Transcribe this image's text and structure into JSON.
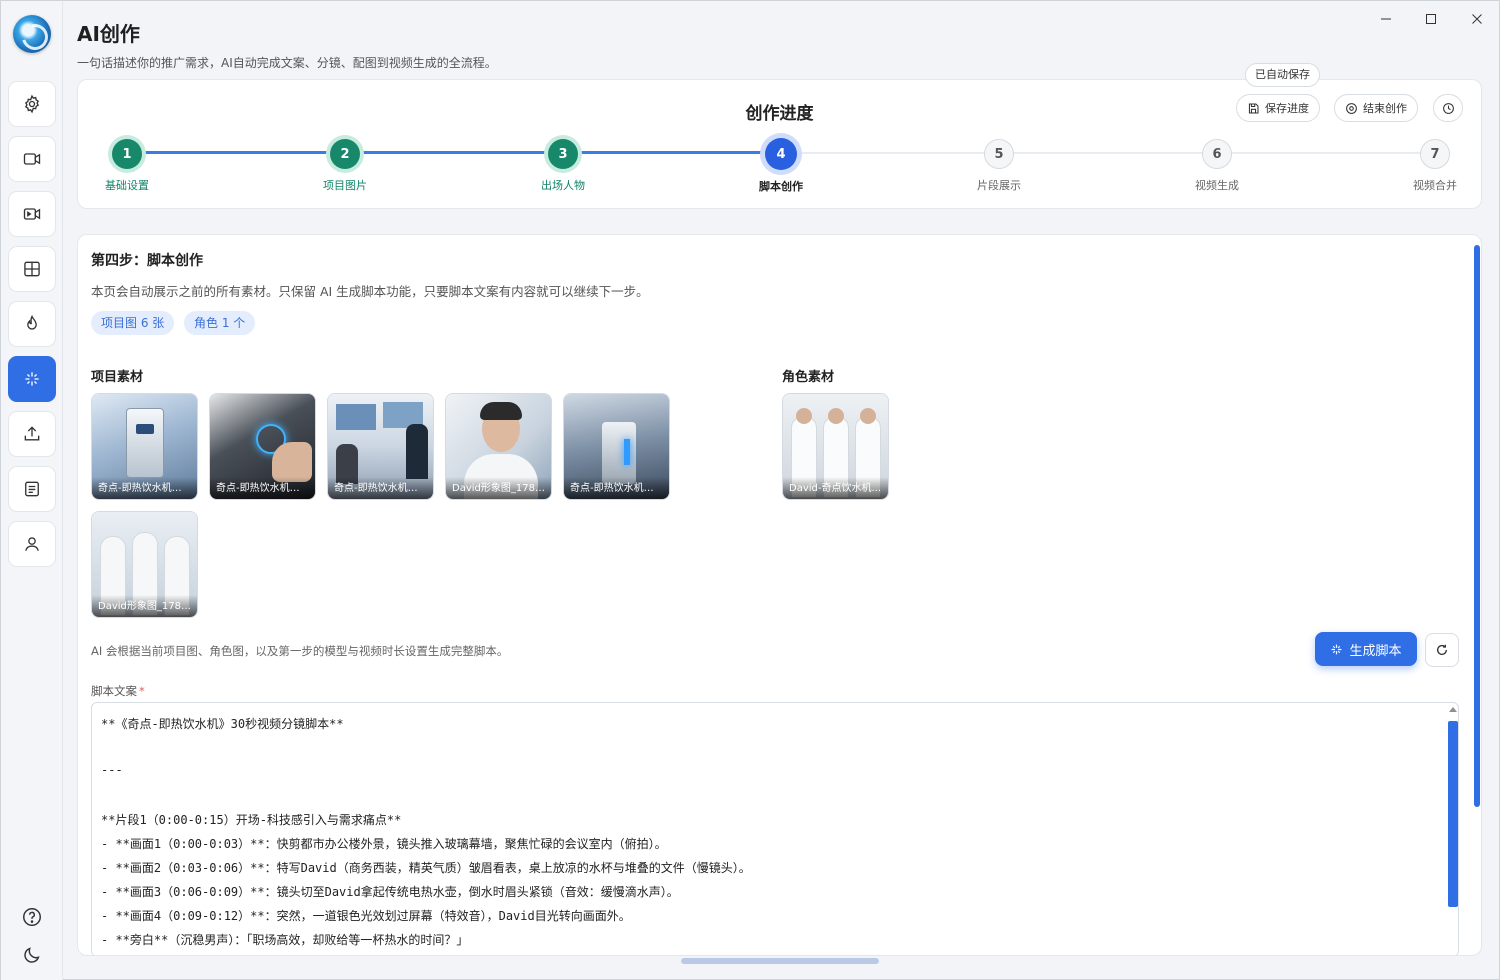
{
  "app": {
    "title": "AI创作",
    "subtitle": "一句话描述你的推广需求，AI自动完成文案、分镜、配图到视频生成的全流程。"
  },
  "sidebar": {
    "items": [
      {
        "name": "settings",
        "icon": "gear-icon"
      },
      {
        "name": "video",
        "icon": "video-camera-icon"
      },
      {
        "name": "video-record",
        "icon": "video-record-icon"
      },
      {
        "name": "grid",
        "icon": "grid-icon"
      },
      {
        "name": "hot",
        "icon": "flame-icon"
      },
      {
        "name": "ai-create",
        "icon": "sparkle-icon",
        "active": true
      },
      {
        "name": "upload",
        "icon": "upload-icon"
      },
      {
        "name": "document",
        "icon": "document-icon"
      },
      {
        "name": "user",
        "icon": "user-icon"
      }
    ],
    "bottom": [
      {
        "name": "help",
        "icon": "help-icon"
      },
      {
        "name": "theme",
        "icon": "moon-icon"
      }
    ]
  },
  "progress": {
    "title": "创作进度",
    "autosave": "已自动保存",
    "save_label": "保存进度",
    "end_label": "结束创作",
    "steps": [
      {
        "num": "1",
        "label": "基础设置",
        "state": "done"
      },
      {
        "num": "2",
        "label": "项目图片",
        "state": "done"
      },
      {
        "num": "3",
        "label": "出场人物",
        "state": "done"
      },
      {
        "num": "4",
        "label": "脚本创作",
        "state": "current"
      },
      {
        "num": "5",
        "label": "片段展示",
        "state": "todo"
      },
      {
        "num": "6",
        "label": "视频生成",
        "state": "todo"
      },
      {
        "num": "7",
        "label": "视频合并",
        "state": "todo"
      }
    ]
  },
  "main": {
    "step_title": "第四步：脚本创作",
    "description": "本页会自动展示之前的所有素材。只保留 AI 生成脚本功能，只要脚本文案有内容就可以继续下一步。",
    "chips": [
      "项目图 6 张",
      "角色 1 个"
    ],
    "project_section_title": "项目素材",
    "role_section_title": "角色素材",
    "project_images": [
      {
        "caption": "奇点-即热饮水机项..."
      },
      {
        "caption": "奇点-即热饮水机项..."
      },
      {
        "caption": "奇点-即热饮水机项..."
      },
      {
        "caption": "David形象图_17800..."
      },
      {
        "caption": "奇点-即热饮水机项..."
      },
      {
        "caption": "David形象图_17800..."
      }
    ],
    "role_images": [
      {
        "caption": "David-奇点饮水机..."
      }
    ],
    "ai_note": "AI 会根据当前项目图、角色图，以及第一步的模型与视频时长设置生成完整脚本。",
    "generate_label": "生成脚本",
    "script_label": "脚本文案",
    "script_required": "*",
    "script_lines": [
      "**《奇点-即热饮水机》30秒视频分镜脚本**",
      "",
      "---",
      "",
      "**片段1（0:00-0:15）开场-科技感引入与需求痛点**",
      "- **画面1（0:00-0:03）**：快剪都市办公楼外景，镜头推入玻璃幕墙，聚焦忙碌的会议室内（俯拍）。",
      "- **画面2（0:03-0:06）**：特写David（商务西装，精英气质）皱眉看表，桌上放凉的水杯与堆叠的文件（慢镜头）。",
      "- **画面3（0:06-0:09）**：镜头切至David拿起传统电热水壶，倒水时眉头紧锁（音效：缓慢滴水声）。",
      "- **画面4（0:09-0:12）**：突然，一道银色光效划过屏幕（特效音），David目光转向画面外。",
      "- **旁白**（沉稳男声）：「职场高效，却败给等一杯热水的时间？」"
    ]
  }
}
